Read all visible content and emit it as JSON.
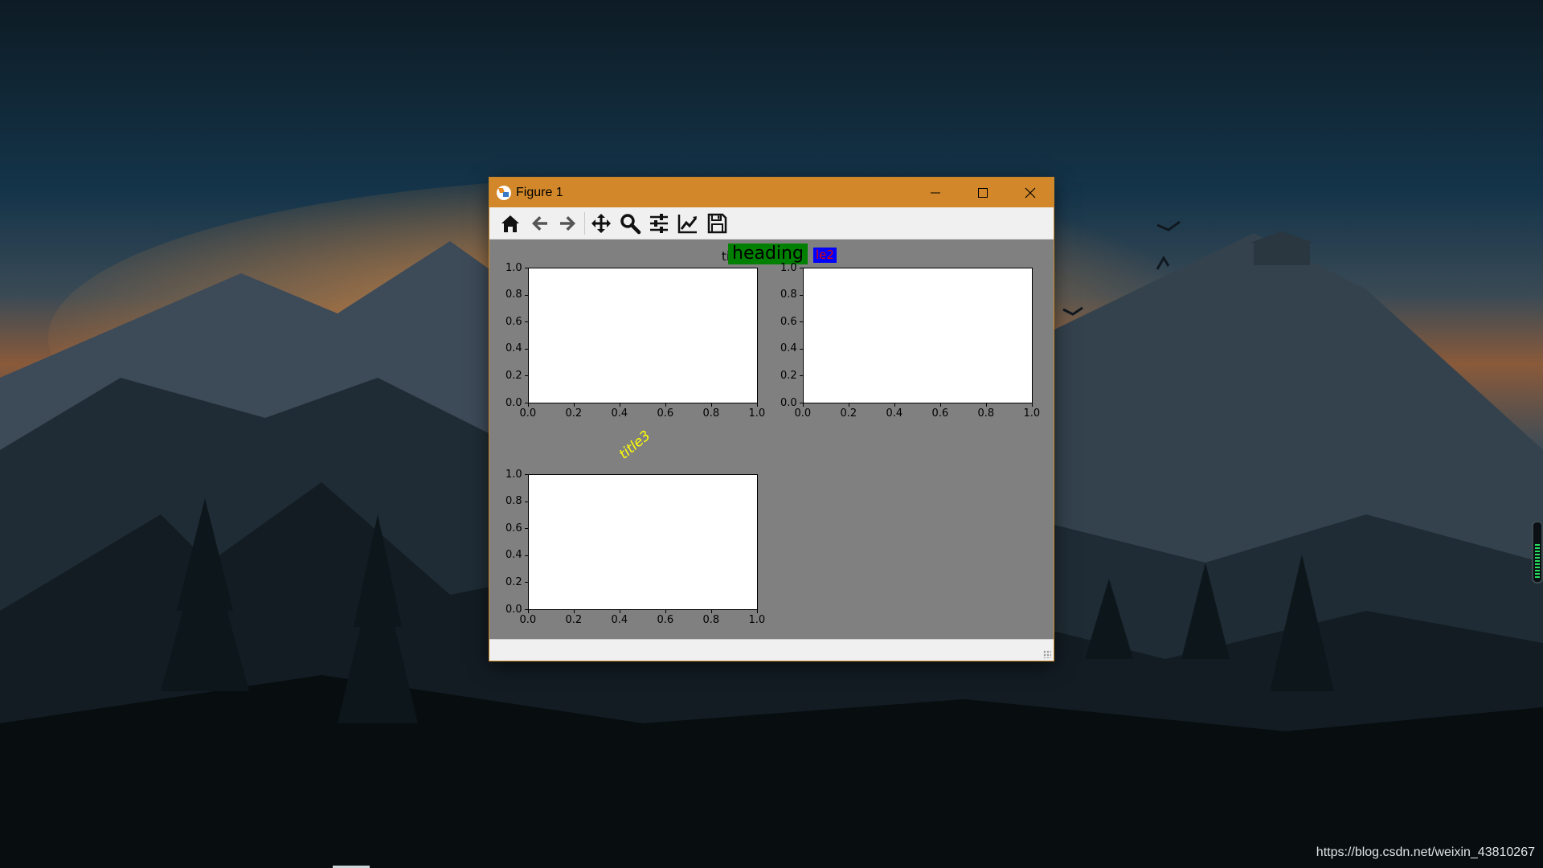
{
  "window": {
    "title": "Figure 1"
  },
  "toolbar": {
    "tools": [
      {
        "icon": "home-icon"
      },
      {
        "icon": "back-arrow-icon"
      },
      {
        "icon": "forward-arrow-icon"
      },
      {
        "icon": "pan-move-icon"
      },
      {
        "icon": "zoom-magnifier-icon"
      },
      {
        "icon": "subplots-config-icon"
      },
      {
        "icon": "edit-axis-curve-icon"
      },
      {
        "icon": "save-floppy-icon"
      }
    ]
  },
  "figure": {
    "suptitle": "heading",
    "subplot_titles": {
      "title1_visible": "ti",
      "title2_visible": "le2",
      "title3": "title3"
    },
    "colors": {
      "figure_bg": "#808080",
      "heading_bg": "#008000",
      "title2_bg": "#0000ff",
      "title2_fg": "#e00000",
      "title3_fg": "#ffff00"
    }
  },
  "chart_data": [
    {
      "type": "line",
      "series": [],
      "xlim": [
        0.0,
        1.0
      ],
      "ylim": [
        0.0,
        1.0
      ],
      "xticks": [
        "0.0",
        "0.2",
        "0.4",
        "0.6",
        "0.8",
        "1.0"
      ],
      "yticks": [
        "0.0",
        "0.2",
        "0.4",
        "0.6",
        "0.8",
        "1.0"
      ],
      "title": "ti",
      "grid": false
    },
    {
      "type": "line",
      "series": [],
      "xlim": [
        0.0,
        1.0
      ],
      "ylim": [
        0.0,
        1.0
      ],
      "xticks": [
        "0.0",
        "0.2",
        "0.4",
        "0.6",
        "0.8",
        "1.0"
      ],
      "yticks": [
        "0.0",
        "0.2",
        "0.4",
        "0.6",
        "0.8",
        "1.0"
      ],
      "title": "le2",
      "grid": false
    },
    {
      "type": "line",
      "series": [],
      "xlim": [
        0.0,
        1.0
      ],
      "ylim": [
        0.0,
        1.0
      ],
      "xticks": [
        "0.0",
        "0.2",
        "0.4",
        "0.6",
        "0.8",
        "1.0"
      ],
      "yticks": [
        "0.0",
        "0.2",
        "0.4",
        "0.6",
        "0.8",
        "1.0"
      ],
      "title": "title3",
      "grid": false
    }
  ],
  "desktop": {
    "watermark": "https://blog.csdn.net/weixin_43810267"
  }
}
